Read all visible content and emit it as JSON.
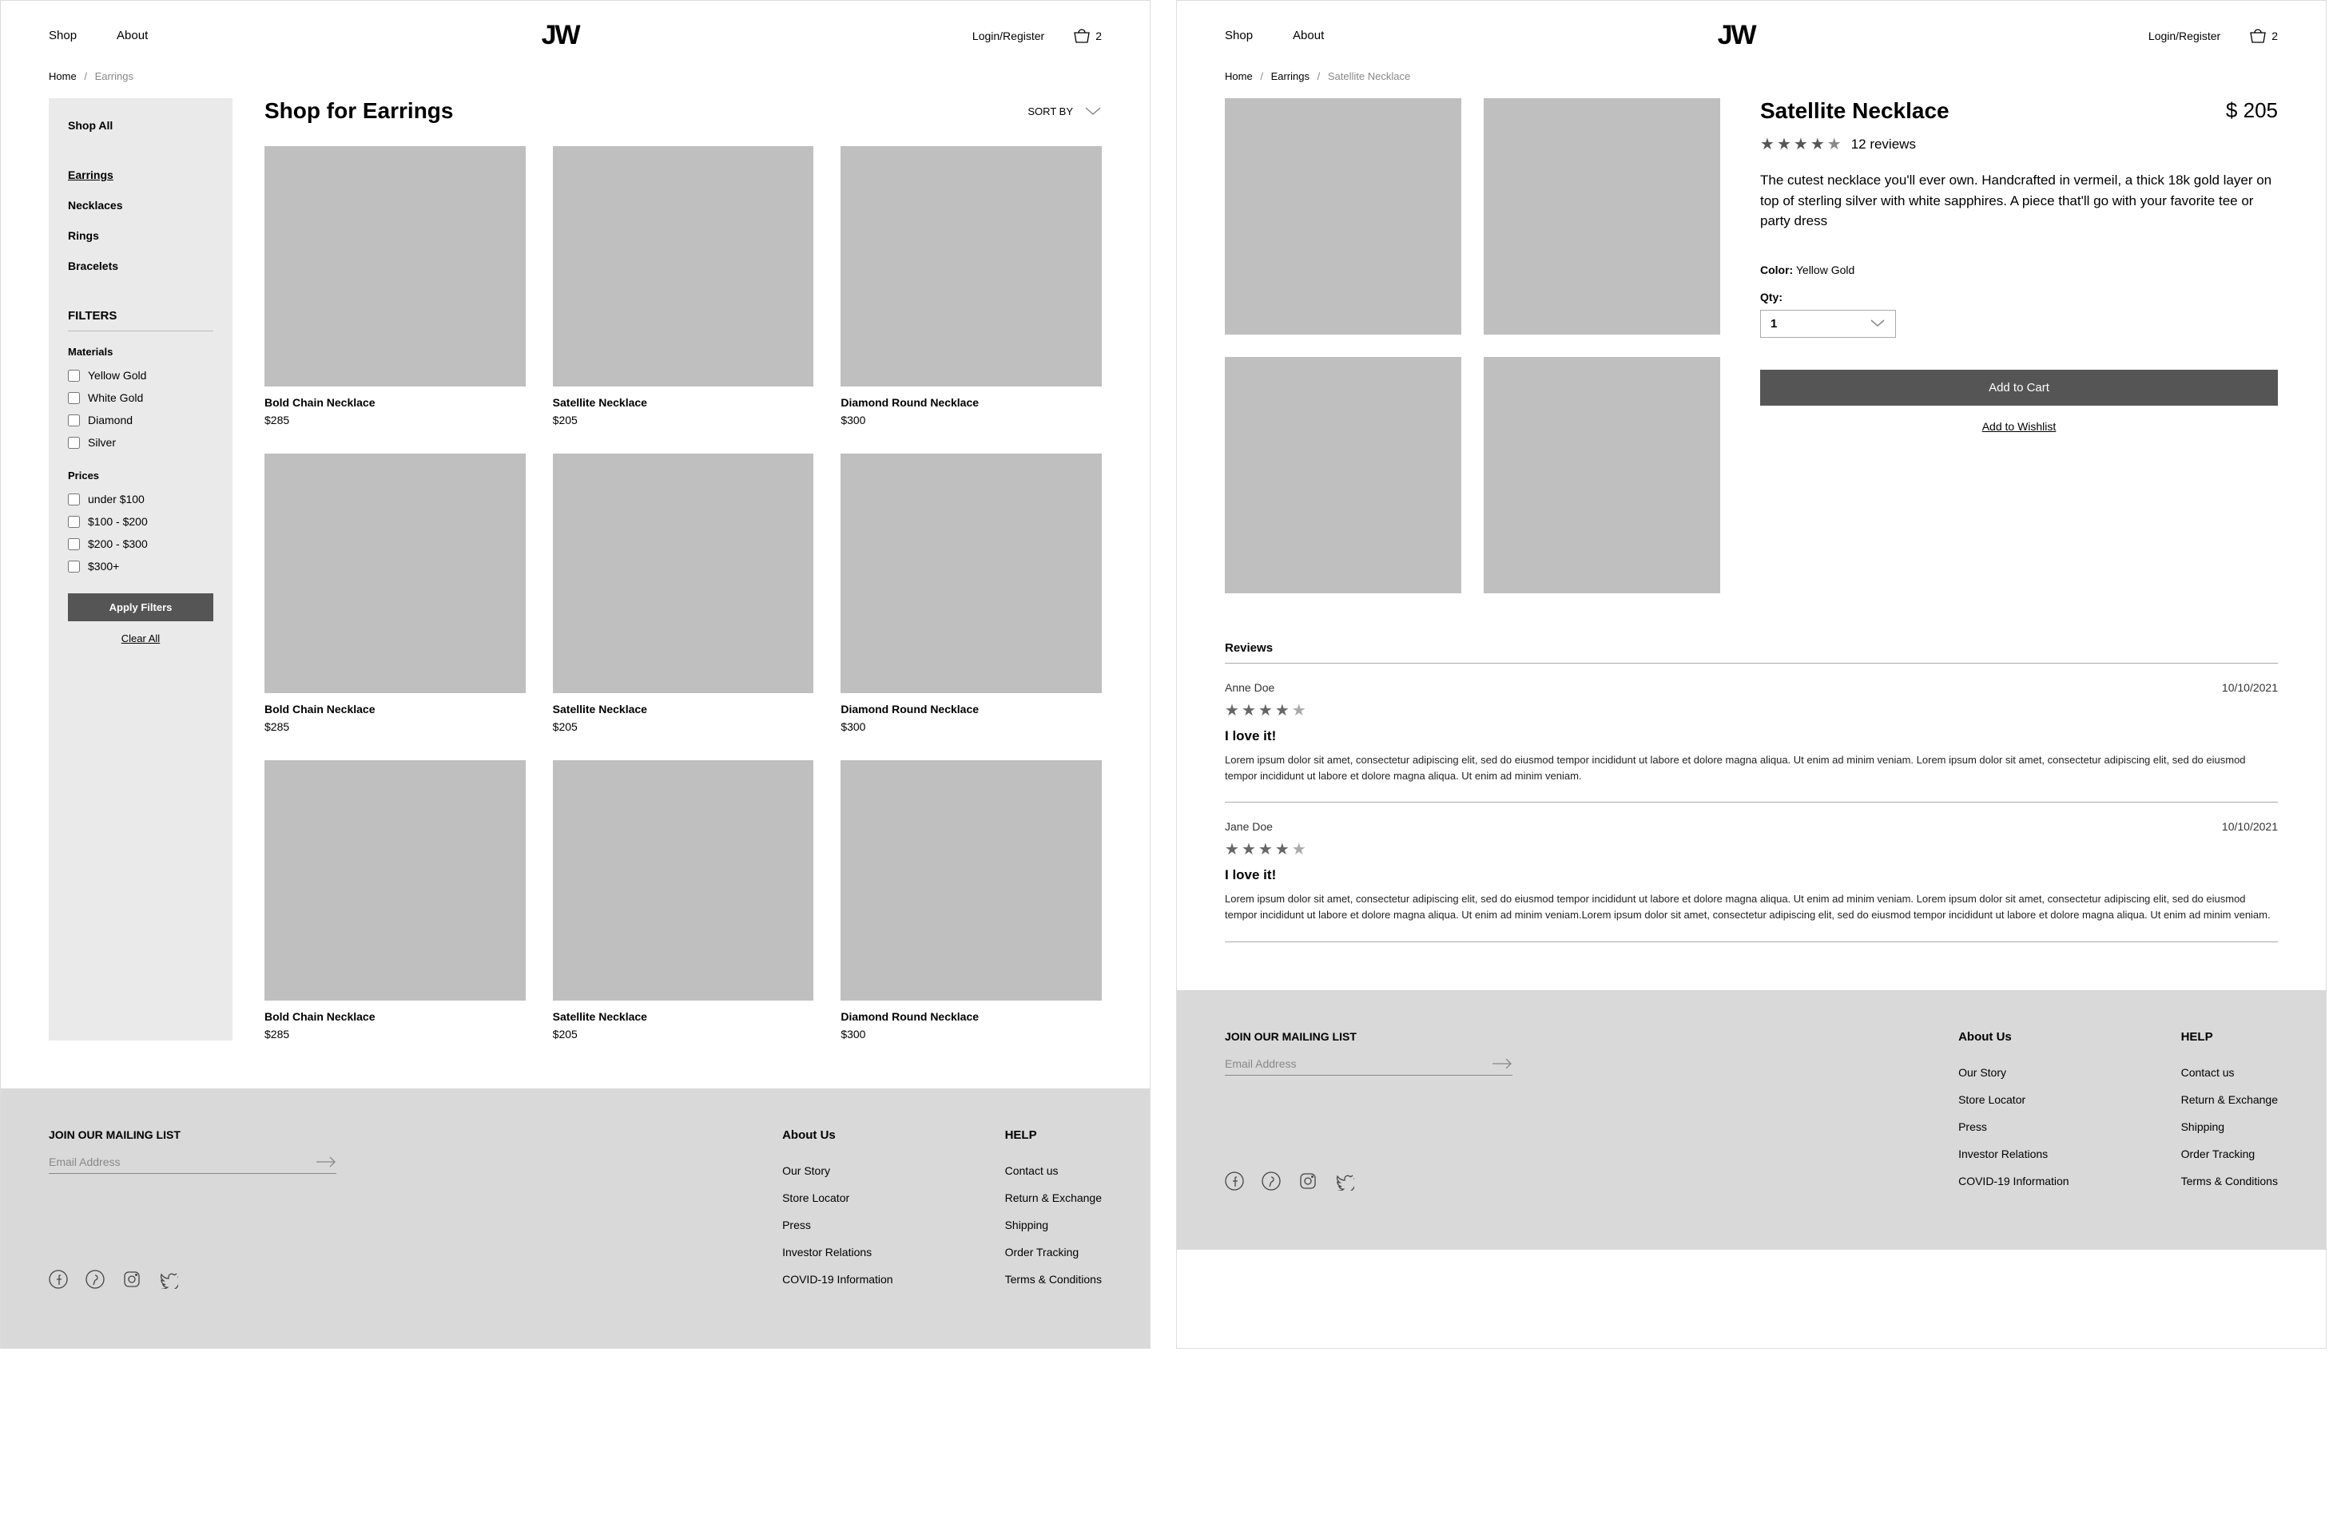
{
  "header": {
    "shop": "Shop",
    "about": "About",
    "logo": "JW",
    "login": "Login/Register",
    "cart_count": "2"
  },
  "categoryPage": {
    "breadcrumb": {
      "home": "Home",
      "current": "Earrings"
    },
    "sidebar": {
      "shopAll": "Shop All",
      "categories": [
        "Earrings",
        "Necklaces",
        "Rings",
        "Bracelets"
      ],
      "filtersTitle": "FILTERS",
      "materialsLabel": "Materials",
      "materials": [
        "Yellow Gold",
        "White Gold",
        "Diamond",
        "Silver"
      ],
      "pricesLabel": "Prices",
      "prices": [
        "under $100",
        "$100 - $200",
        "$200 - $300",
        "$300+"
      ],
      "applyBtn": "Apply Filters",
      "clearAll": "Clear All"
    },
    "listingTitle": "Shop for Earrings",
    "sortBy": "SORT BY",
    "products": [
      {
        "name": "Bold Chain Necklace",
        "price": "$285"
      },
      {
        "name": "Satellite Necklace",
        "price": "$205"
      },
      {
        "name": "Diamond Round Necklace",
        "price": "$300"
      },
      {
        "name": "Bold Chain Necklace",
        "price": "$285"
      },
      {
        "name": "Satellite Necklace",
        "price": "$205"
      },
      {
        "name": "Diamond Round Necklace",
        "price": "$300"
      },
      {
        "name": "Bold Chain Necklace",
        "price": "$285"
      },
      {
        "name": "Satellite Necklace",
        "price": "$205"
      },
      {
        "name": "Diamond Round Necklace",
        "price": "$300"
      }
    ]
  },
  "productPage": {
    "breadcrumb": {
      "home": "Home",
      "cat": "Earrings",
      "current": "Satellite Necklace"
    },
    "title": "Satellite Necklace",
    "price": "$ 205",
    "reviewsCount": "12 reviews",
    "rating": 4,
    "description": "The cutest necklace you'll ever own. Handcrafted in vermeil, a thick 18k gold layer on top of sterling silver with white sapphires. A piece that'll go with your favorite tee or party dress",
    "colorLabel": "Color:",
    "colorValue": "Yellow Gold",
    "qtyLabel": "Qty:",
    "qtyValue": "1",
    "addToCart": "Add to Cart",
    "addToWishlist": "Add to Wishlist",
    "reviewsHeading": "Reviews",
    "reviews": [
      {
        "author": "Anne Doe",
        "date": "10/10/2021",
        "rating": 4,
        "title": "I love it!",
        "body": "Lorem ipsum dolor sit amet, consectetur adipiscing elit, sed do eiusmod tempor incididunt ut labore et dolore magna aliqua. Ut enim ad minim veniam. Lorem ipsum dolor sit amet, consectetur adipiscing elit, sed do eiusmod tempor incididunt ut labore et dolore magna aliqua. Ut enim ad minim veniam."
      },
      {
        "author": "Jane Doe",
        "date": "10/10/2021",
        "rating": 4,
        "title": "I love it!",
        "body": "Lorem ipsum dolor sit amet, consectetur adipiscing elit, sed do eiusmod tempor incididunt ut labore et dolore magna aliqua. Ut enim ad minim veniam. Lorem ipsum dolor sit amet, consectetur adipiscing elit, sed do eiusmod tempor incididunt ut labore et dolore magna aliqua. Ut enim ad minim veniam.Lorem ipsum dolor sit amet, consectetur adipiscing elit, sed do eiusmod tempor incididunt ut labore et dolore magna aliqua. Ut enim ad minim veniam."
      }
    ]
  },
  "footer": {
    "mailing": "JOIN OUR MAILING LIST",
    "emailPlaceholder": "Email Address",
    "aboutTitle": "About Us",
    "aboutLinks": [
      "Our Story",
      "Store Locator",
      "Press",
      "Investor Relations",
      "COVID-19 Information"
    ],
    "helpTitle": "HELP",
    "helpLinks": [
      "Contact us",
      "Return & Exchange",
      "Shipping",
      "Order Tracking",
      "Terms & Conditions"
    ]
  }
}
